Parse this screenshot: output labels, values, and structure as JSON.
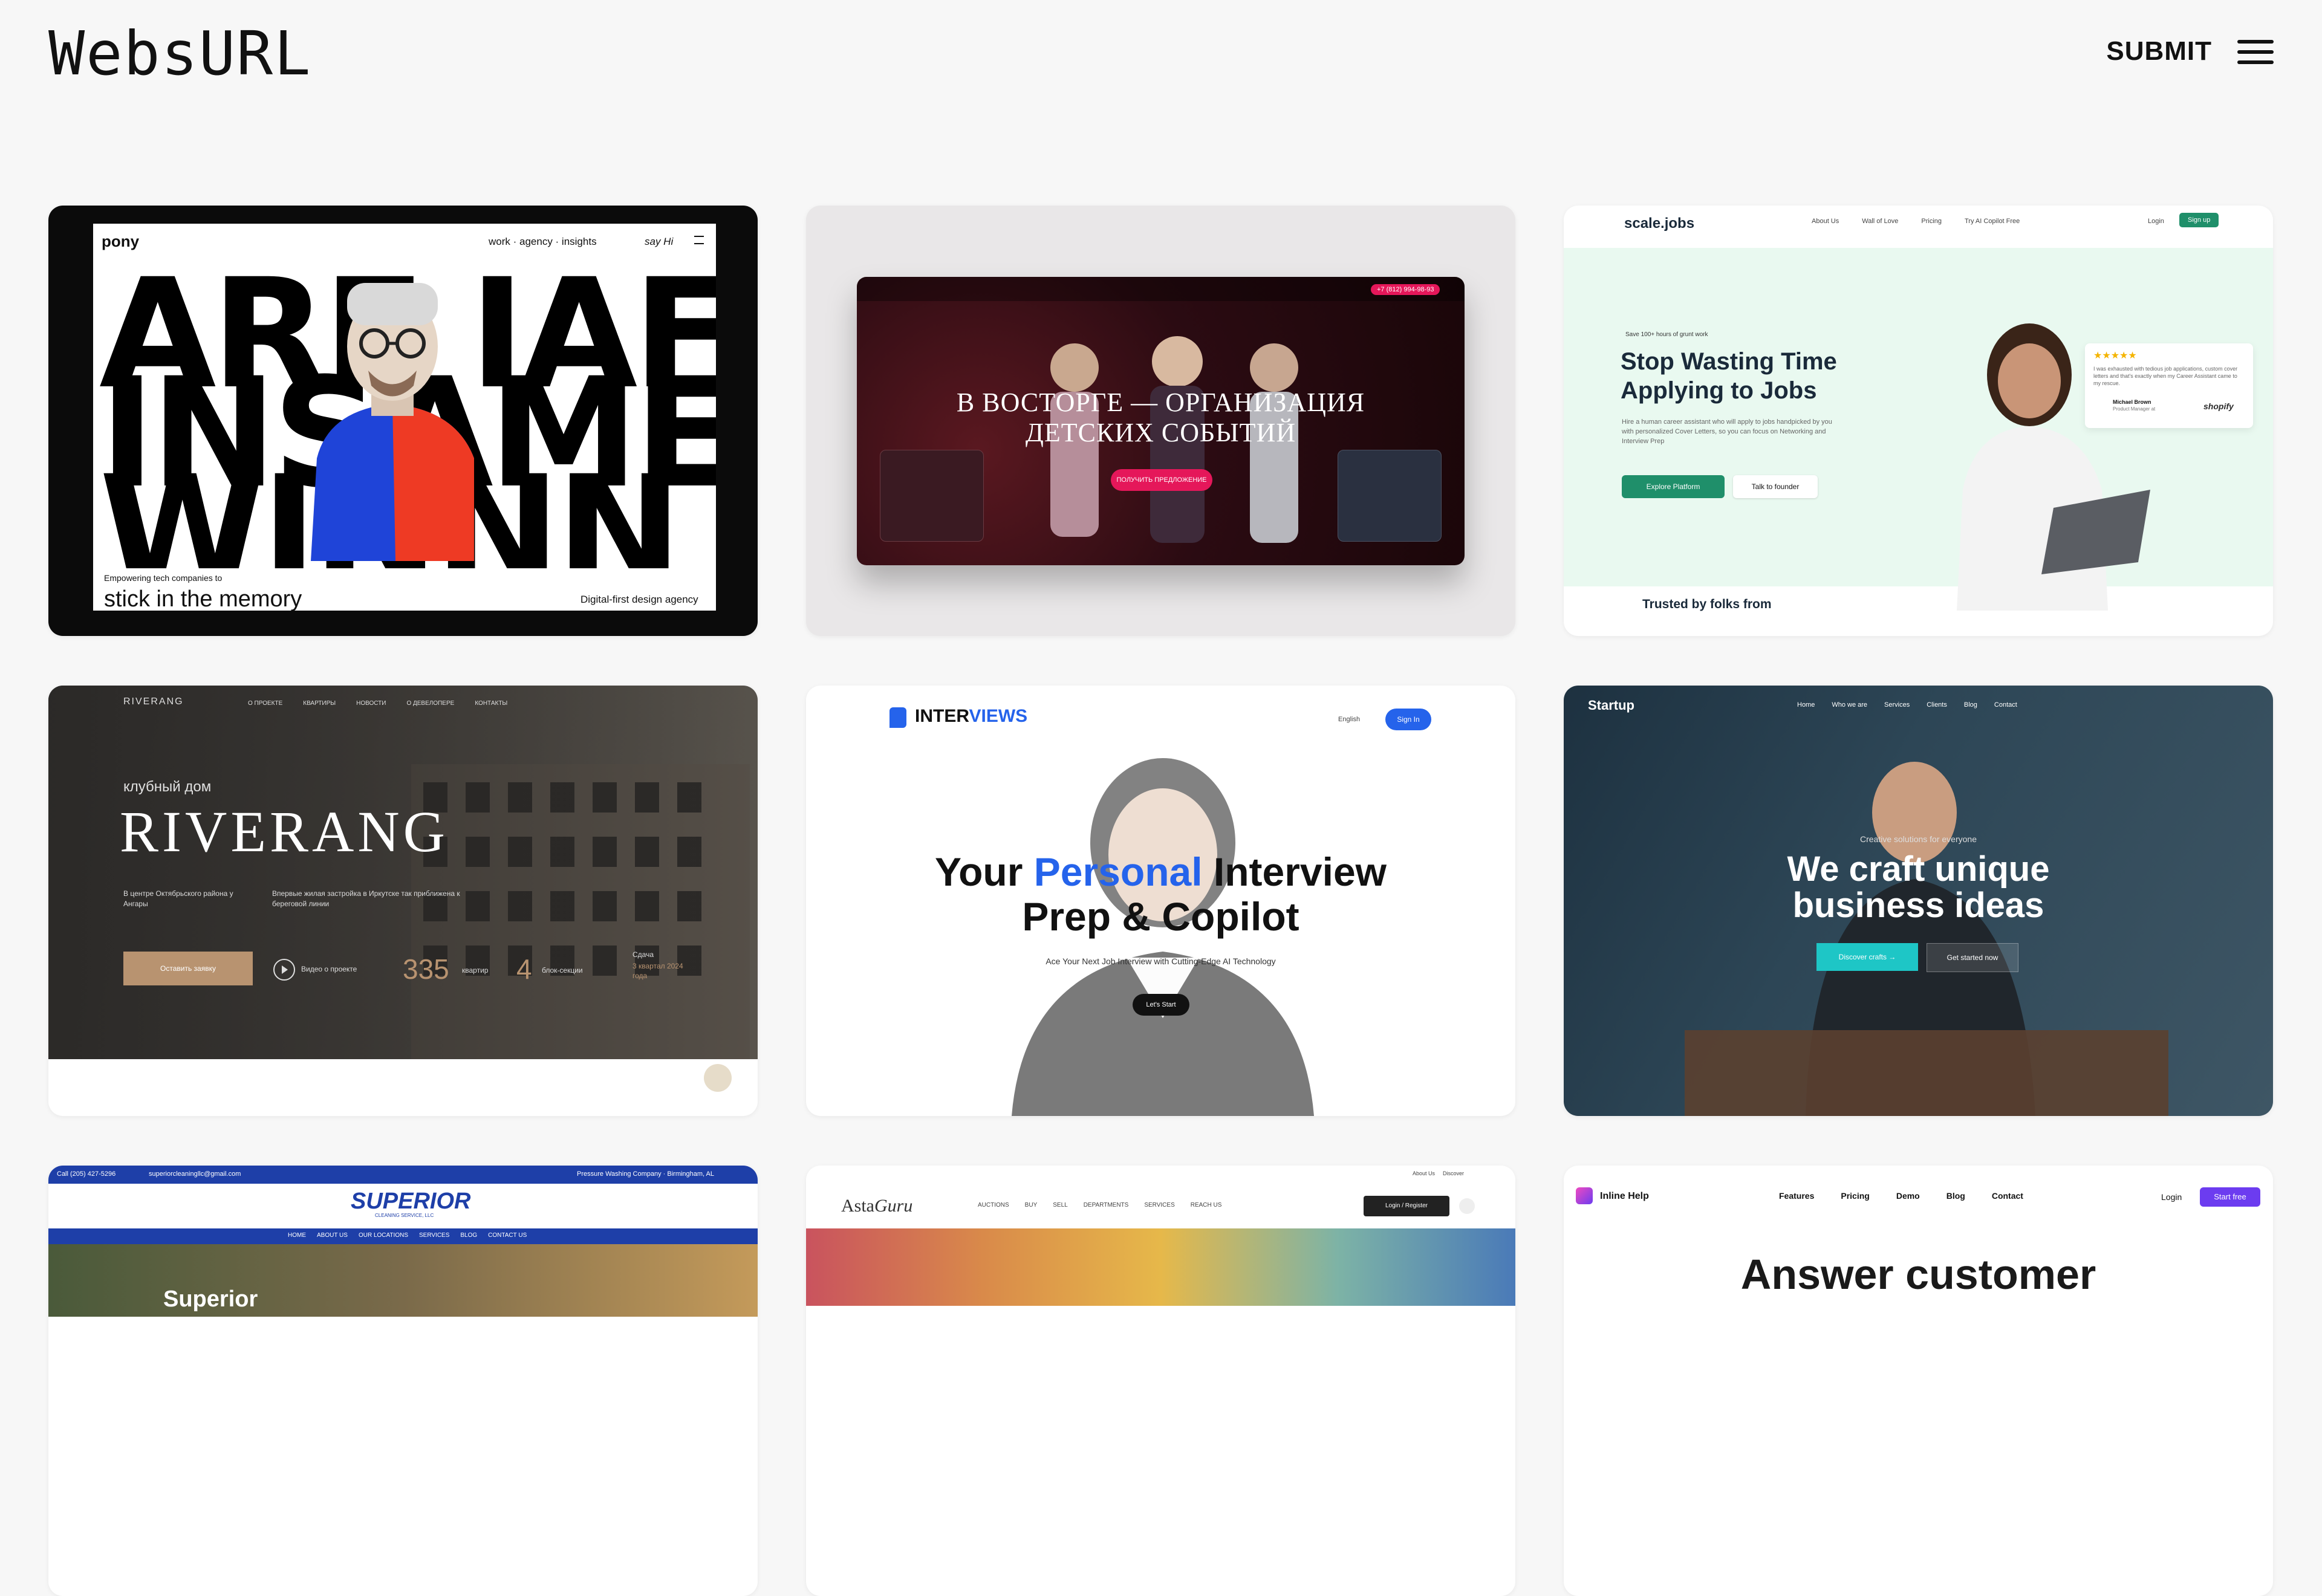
{
  "header": {
    "logo": "WebsURL",
    "submit": "SUBMIT"
  },
  "cards": {
    "pony": {
      "logo": "pony",
      "nav": "work · agency · insights",
      "sayhi": "say Hi",
      "big1": "ARE IAF",
      "big2": "INSAME",
      "big3": "WINNN",
      "tagline_small": "Empowering tech companies to",
      "tagline": "stick in the memory",
      "corner": "Digital-first design agency"
    },
    "events": {
      "headline1": "В ВОСТОРГЕ — ОРГАНИЗАЦИЯ",
      "headline2": "ДЕТСКИХ СОБЫТИЙ",
      "cta": "ПОЛУЧИТЬ ПРЕДЛОЖЕНИЕ",
      "phone": "+7 (812) 994-98-93"
    },
    "scalejobs": {
      "logo": "scale.jobs",
      "nav": [
        "About Us",
        "Wall of Love",
        "Pricing",
        "Try AI Copilot Free"
      ],
      "login": "Login",
      "signup": "Sign up",
      "eyebrow": "Save 100+ hours of grunt work",
      "title1": "Stop Wasting Time",
      "title2": "Applying to Jobs",
      "body": "Hire a human career assistant who will apply to jobs handpicked by you with personalized Cover Letters, so you can focus on Networking and Interview Prep",
      "cta1": "Explore Platform",
      "cta2": "Talk to founder",
      "stars": "★★★★★",
      "quote": "I was exhausted with tedious job applications, custom cover letters and that's exactly when my Career Assistant came to my rescue.",
      "reviewer": "Michael Brown",
      "reviewer_role": "Product Manager at",
      "brand": "shopify",
      "trusted": "Trusted by folks from"
    },
    "riverang": {
      "logo": "RIVERANG",
      "nav": [
        "О ПРОЕКТЕ",
        "КВАРТИРЫ",
        "НОВОСТИ",
        "О ДЕВЕЛОПЕРЕ",
        "КОНТАКТЫ"
      ],
      "subtitle": "клубный дом",
      "title": "RIVERANG",
      "desc1": "В центре Октябрьского района у Ангары",
      "desc2": "Впервые жилая застройка в Иркутске так приближена к береговой линии",
      "cta": "Оставить заявку",
      "video": "Видео о проекте",
      "stat1": "335",
      "stat1_label": "квартир",
      "stat2": "4",
      "stat2_label": "блок-секции",
      "stat3_label": "Сдача",
      "stat3": "3 квартал 2024 года"
    },
    "interviews": {
      "logo_a": "INTER",
      "logo_b": "VIEWS",
      "lang": "English",
      "signin": "Sign In",
      "title_a": "Your ",
      "title_b": "Personal",
      "title_c": " Interview",
      "title2": "Prep & Copilot",
      "sub": "Ace Your Next Job Interview with Cutting-Edge AI Technology",
      "cta": "Let's Start"
    },
    "startup": {
      "logo": "Startup",
      "nav": [
        "Home",
        "Who we are",
        "Services",
        "Clients",
        "Blog",
        "Contact"
      ],
      "eyebrow": "Creative solutions for everyone",
      "title1": "We craft unique",
      "title2": "business ideas",
      "cta1": "Discover crafts →",
      "cta2": "Get started now"
    },
    "superior": {
      "phone": "Call (205) 427-5296",
      "email": "superiorcleaningllc@gmail.com",
      "tag": "Pressure Washing Company · Birmingham, AL",
      "logo": "SUPERIOR",
      "logo_sub": "CLEANING SERVICE, LLC",
      "nav": [
        "HOME",
        "ABOUT US",
        "OUR LOCATIONS",
        "SERVICES",
        "BLOG",
        "CONTACT US"
      ],
      "hero": "Superior"
    },
    "astaguru": {
      "top": [
        "About Us",
        "Discover"
      ],
      "logo_a": "Asta",
      "logo_b": "Guru",
      "nav": [
        "AUCTIONS",
        "BUY",
        "SELL",
        "DEPARTMENTS",
        "SERVICES",
        "REACH US"
      ],
      "login": "Login / Register"
    },
    "inlinehelp": {
      "logo": "Inline Help",
      "nav": [
        "Features",
        "Pricing",
        "Demo",
        "Blog",
        "Contact"
      ],
      "login": "Login",
      "cta": "Start free",
      "title": "Answer customer"
    }
  },
  "colors": {
    "page_bg": "#f7f7f7",
    "scale_green": "#1f8f6a",
    "interviews_blue": "#2563eb",
    "startup_cyan": "#1ec6c6",
    "inline_purple": "#6c3cf0"
  },
  "icons": [
    "menu-icon",
    "play-icon",
    "search-icon",
    "chat-icon"
  ]
}
